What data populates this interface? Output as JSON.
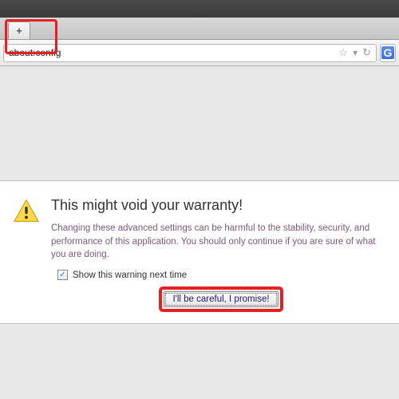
{
  "url": "about:config",
  "newtab_glyph": "+",
  "star_glyph": "☆",
  "dropdown_glyph": "▾",
  "reload_glyph": "↻",
  "search_engine_letter": "G",
  "warning": {
    "heading": "This might void your warranty!",
    "body": "Changing these advanced settings can be harmful to the stability, security, and performance of this application. You should only continue if you are sure of what you are doing.",
    "checkbox_label": "Show this warning next time",
    "checkbox_checked_glyph": "✓",
    "button_label": "I'll be careful, I promise!"
  }
}
